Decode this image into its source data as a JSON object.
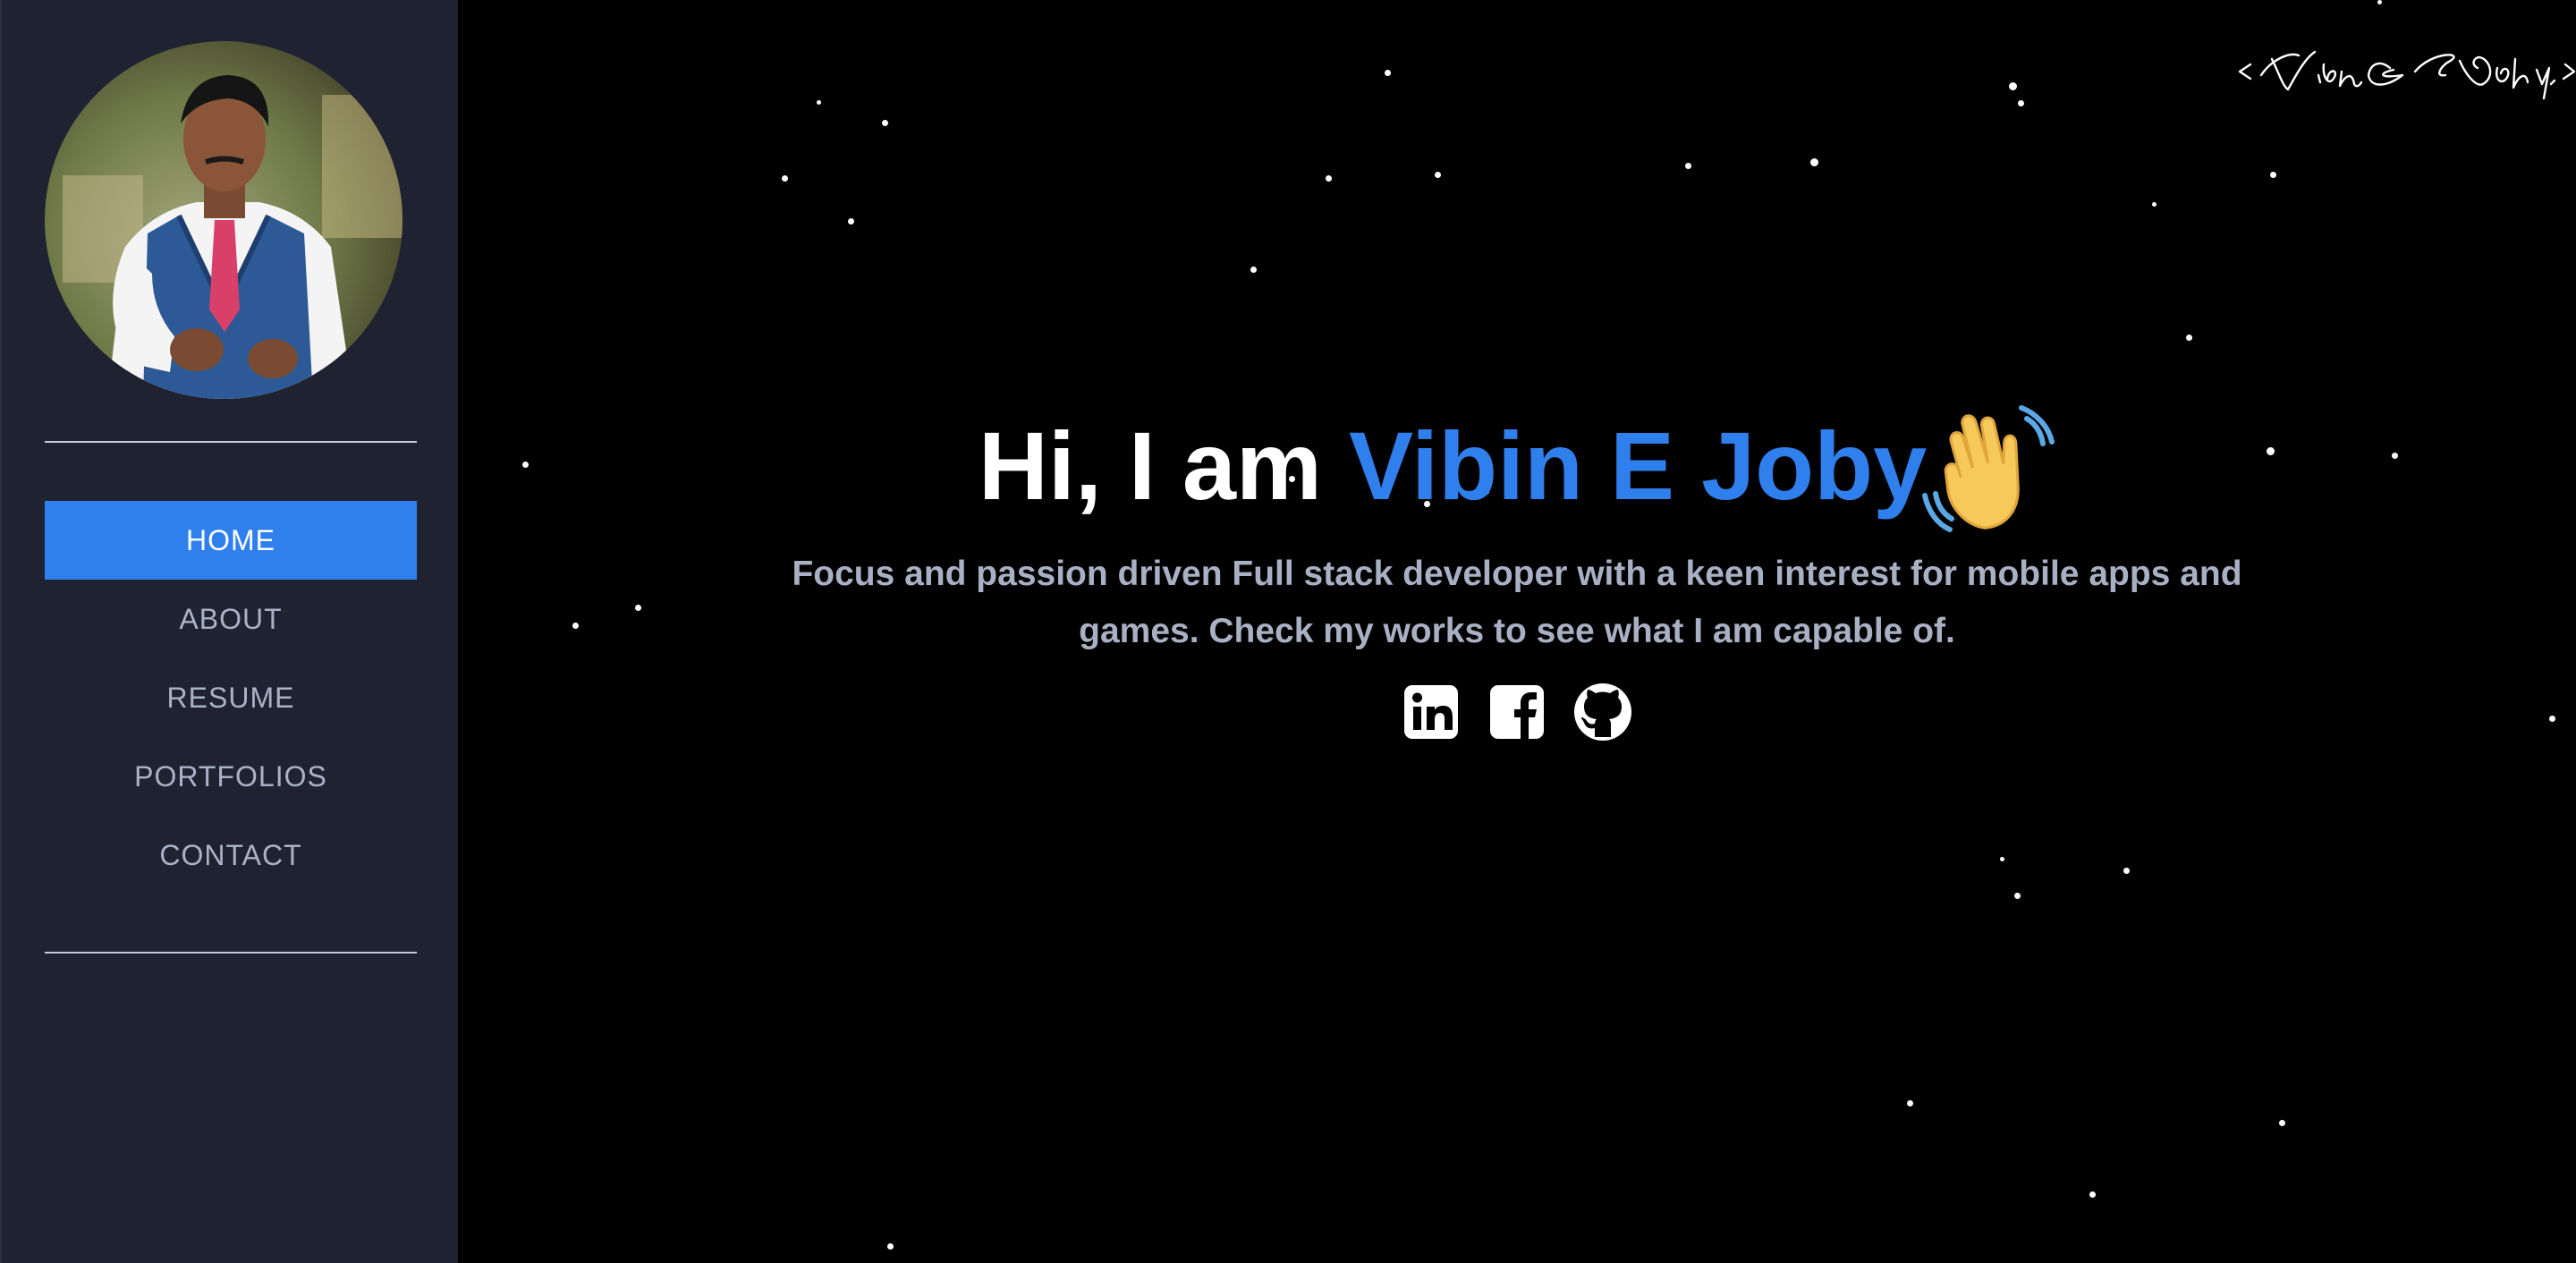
{
  "sidebar": {
    "nav": [
      {
        "label": "HOME",
        "active": true
      },
      {
        "label": "ABOUT",
        "active": false
      },
      {
        "label": "RESUME",
        "active": false
      },
      {
        "label": "PORTFOLIOS",
        "active": false
      },
      {
        "label": "CONTACT",
        "active": false
      }
    ]
  },
  "hero": {
    "greeting": "Hi, I am",
    "name": "Vibin E Joby",
    "wave_icon": "waving-hand-emoji",
    "tagline": "Focus and passion driven Full stack developer with a keen interest for mobile apps and games. Check my works to see what I am capable of."
  },
  "signature": {
    "text": "< Vibin E Joby />"
  },
  "socials": [
    {
      "name": "linkedin-icon"
    },
    {
      "name": "facebook-icon"
    },
    {
      "name": "github-icon"
    }
  ],
  "colors": {
    "accent": "#2f80ed",
    "sidebar_bg": "#1f2230",
    "background": "#000000",
    "nav_text": "#aab2c8",
    "tagline": "#a8b0c4"
  }
}
